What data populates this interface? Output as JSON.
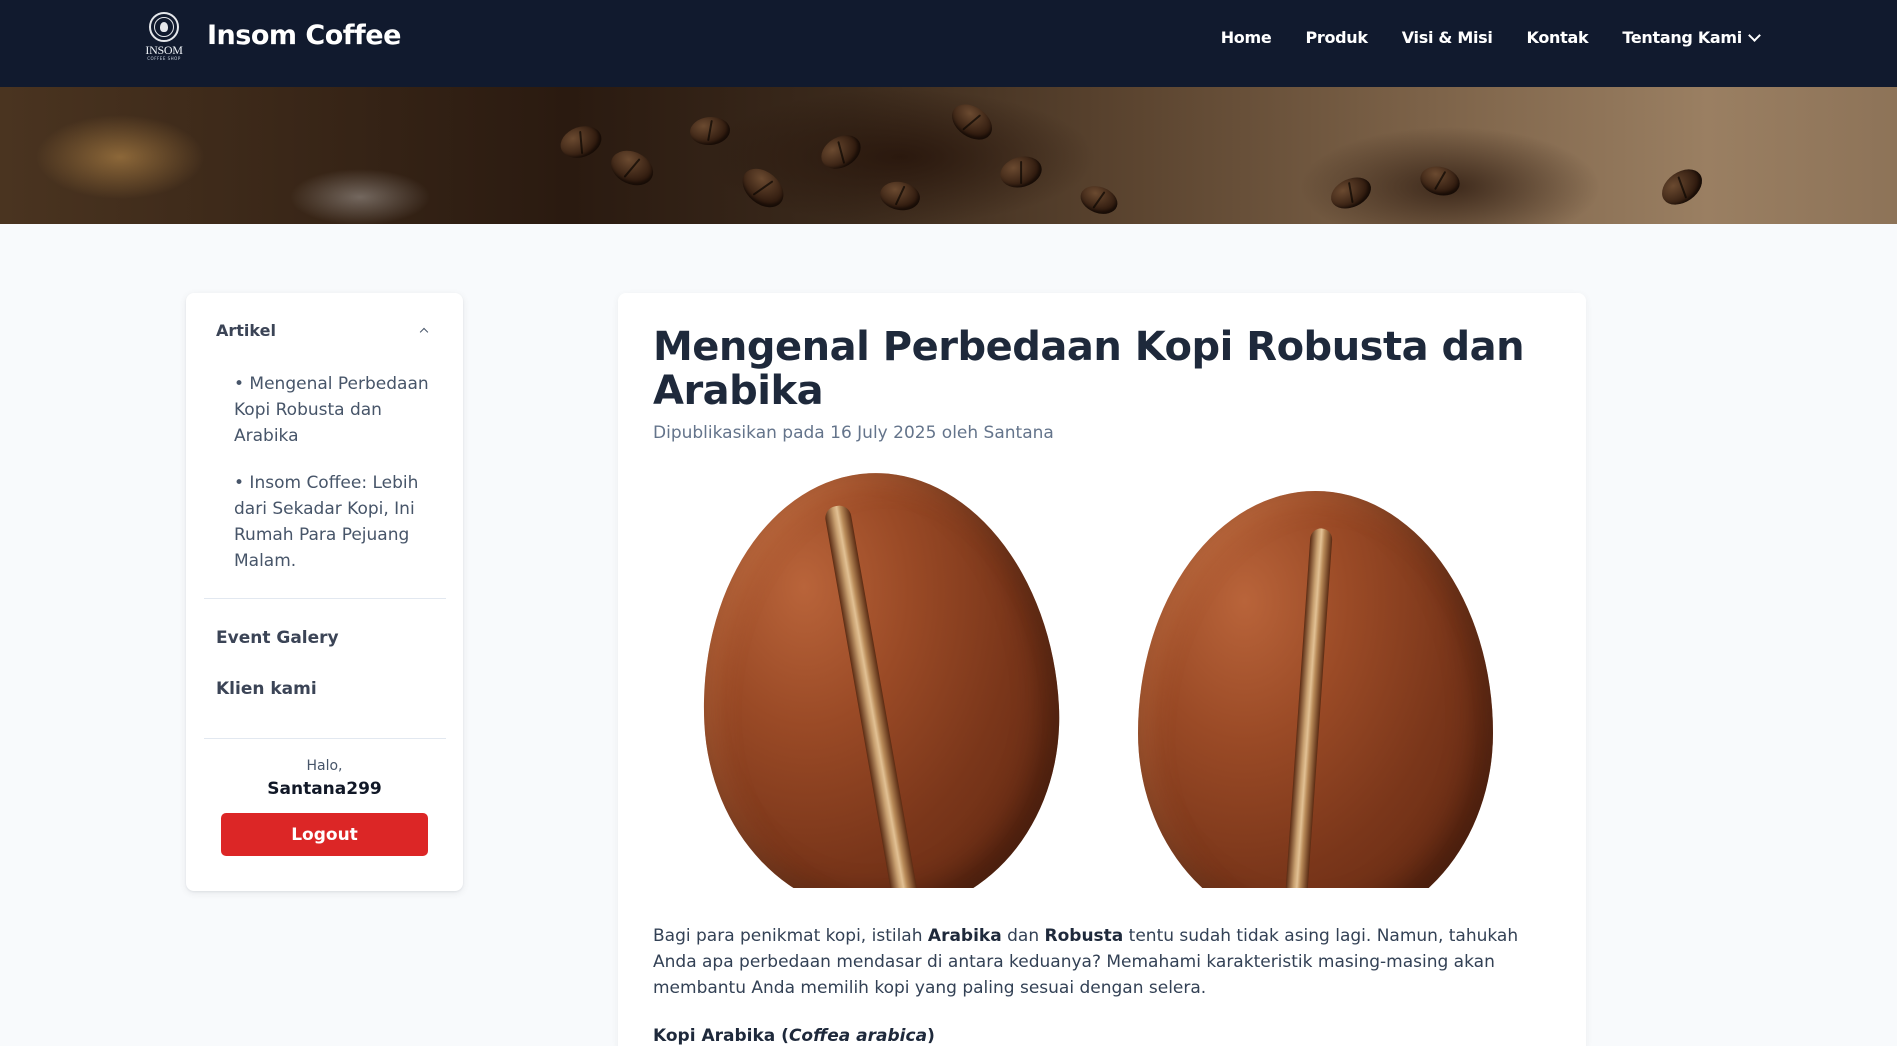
{
  "navbar": {
    "logo_word": "INSOM",
    "logo_sub": "COFFEE SHOP",
    "brand": "Insom Coffee",
    "links": [
      {
        "label": "Home"
      },
      {
        "label": "Produk"
      },
      {
        "label": "Visi & Misi"
      },
      {
        "label": "Kontak"
      },
      {
        "label": "Tentang Kami"
      }
    ]
  },
  "sidebar": {
    "section_title": "Artikel",
    "articles": [
      {
        "label": "• Mengenal Perbedaan Kopi Robusta dan Arabika"
      },
      {
        "label": "• Insom Coffee: Lebih dari Sekadar Kopi, Ini Rumah Para Pejuang Malam."
      }
    ],
    "links": [
      {
        "label": "Event Galery"
      },
      {
        "label": "Klien kami"
      }
    ],
    "greeting": "Halo,",
    "username": "Santana299",
    "logout_label": "Logout"
  },
  "article": {
    "title": "Mengenal Perbedaan Kopi Robusta dan Arabika",
    "meta": "Dipublikasikan pada 16 July 2025 oleh Santana",
    "paragraph": {
      "part1": "Bagi para penikmat kopi, istilah ",
      "bold1": "Arabika",
      "part2": " dan ",
      "bold2": "Robusta",
      "part3": " tentu sudah tidak asing lagi. Namun, tahukah Anda apa perbedaan mendasar di antara keduanya? Memahami karakteristik masing-masing akan membantu Anda memilih kopi yang paling sesuai dengan selera."
    },
    "subheading": {
      "prefix": "Kopi Arabika (",
      "italic": "Coffea arabica",
      "suffix": ")"
    }
  },
  "colors": {
    "navbar_bg": "#111a2e",
    "page_bg": "#f8fafc",
    "logout_bg": "#dc2626",
    "title": "#1e293b"
  },
  "icons": {
    "nav_dropdown": "chevron-down-icon",
    "section_toggle": "chevron-up-icon",
    "logo": "insom-seal-logo"
  }
}
